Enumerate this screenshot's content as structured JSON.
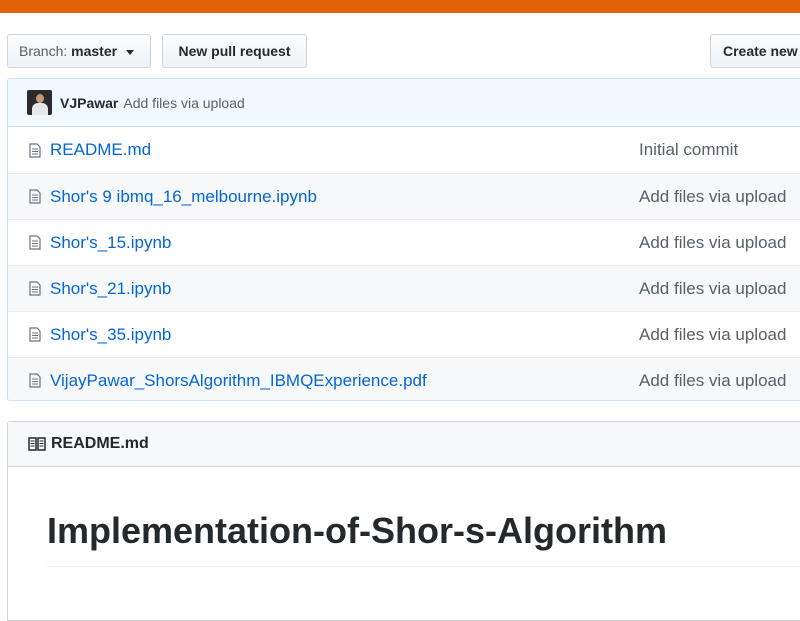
{
  "accent_color": "#e36209",
  "toolbar": {
    "branch_label": "Branch:",
    "branch_name": "master",
    "new_pr_label": "New pull request",
    "create_label": "Create new file"
  },
  "commit": {
    "author": "VJPawar",
    "message": "Add files via upload"
  },
  "files": [
    {
      "name": "README.md",
      "message": "Initial commit",
      "icon": "file-icon"
    },
    {
      "name": "Shor's 9 ibmq_16_melbourne.ipynb",
      "message": "Add files via upload",
      "icon": "file-icon"
    },
    {
      "name": "Shor's_15.ipynb",
      "message": "Add files via upload",
      "icon": "file-icon"
    },
    {
      "name": "Shor's_21.ipynb",
      "message": "Add files via upload",
      "icon": "file-icon"
    },
    {
      "name": "Shor's_35.ipynb",
      "message": "Add files via upload",
      "icon": "file-icon"
    },
    {
      "name": "VijayPawar_ShorsAlgorithm_IBMQExperience.pdf",
      "message": "Add files via upload",
      "icon": "file-icon"
    }
  ],
  "readme": {
    "header": "README.md",
    "title": "Implementation-of-Shor-s-Algorithm"
  }
}
